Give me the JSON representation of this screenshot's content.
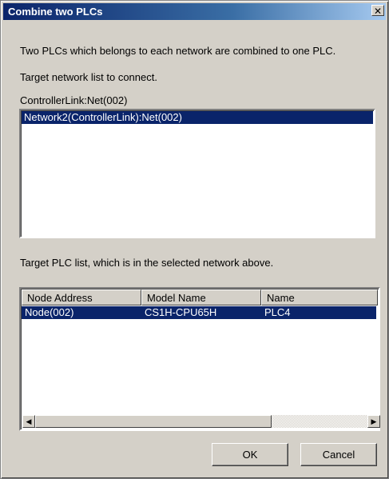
{
  "window": {
    "title": "Combine two PLCs",
    "close_glyph": "✕"
  },
  "description": "Two PLCs which belongs to each network are combined to one PLC.",
  "network_section": {
    "label": "Target network list to connect.",
    "current_network": "ControllerLink:Net(002)",
    "items": [
      "Network2(ControllerLink):Net(002)"
    ],
    "selected_index": 0
  },
  "plc_section": {
    "label": "Target PLC list, which is in the selected network above.",
    "columns": [
      "Node Address",
      "Model Name",
      "Name"
    ],
    "rows": [
      [
        "Node(002)",
        "CS1H-CPU65H",
        "PLC4"
      ]
    ],
    "selected_index": 0
  },
  "scrollbar": {
    "left_arrow": "◀",
    "right_arrow": "▶"
  },
  "buttons": {
    "ok": "OK",
    "cancel": "Cancel"
  },
  "colors": {
    "selection": "#0a246a",
    "face": "#d4d0c8"
  }
}
